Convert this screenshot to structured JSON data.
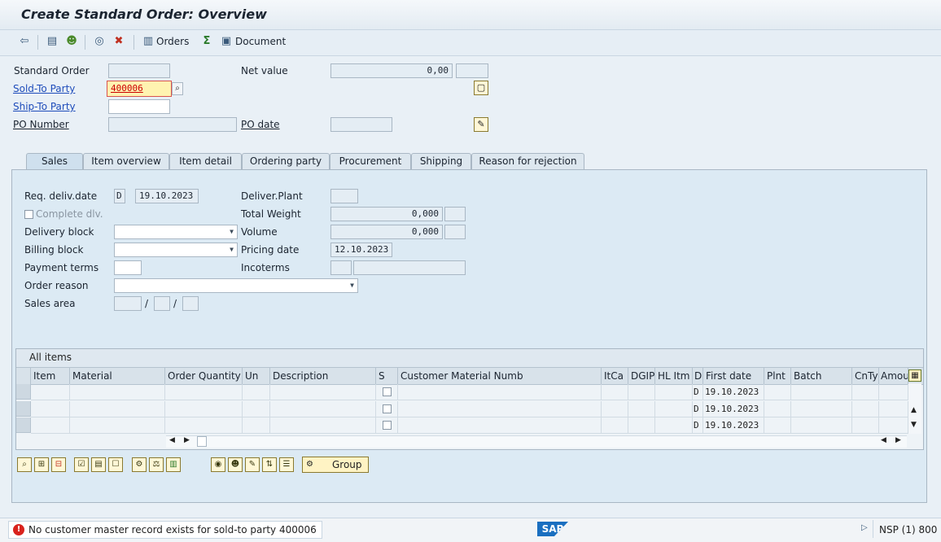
{
  "window": {
    "title": "Create Standard Order: Overview"
  },
  "toolbar": {
    "orders_label": "Orders",
    "document_label": "Document",
    "icons": [
      "display-document-flow-icon",
      "header-icon",
      "partner-icon",
      "status-icon",
      "delete-icon",
      "orders-list-icon",
      "sum-icon",
      "document-icon"
    ]
  },
  "header": {
    "standard_order": {
      "label": "Standard Order",
      "value": ""
    },
    "net_value": {
      "label": "Net value",
      "value": "0,00",
      "currency": ""
    },
    "sold_to": {
      "label": "Sold-To Party",
      "value": "400006"
    },
    "ship_to": {
      "label": "Ship-To Party",
      "value": ""
    },
    "po_number": {
      "label": "PO Number",
      "value": ""
    },
    "po_date": {
      "label": "PO date",
      "value": ""
    }
  },
  "tabs": [
    {
      "label": "Sales",
      "active": true
    },
    {
      "label": "Item overview"
    },
    {
      "label": "Item detail"
    },
    {
      "label": "Ordering party"
    },
    {
      "label": "Procurement"
    },
    {
      "label": "Shipping"
    },
    {
      "label": "Reason for rejection"
    }
  ],
  "sales": {
    "req_deliv_date": {
      "label": "Req. deliv.date",
      "format": "D",
      "value": "19.10.2023"
    },
    "complete_dlv": {
      "label": "Complete dlv."
    },
    "delivery_block": {
      "label": "Delivery block",
      "value": ""
    },
    "billing_block": {
      "label": "Billing block",
      "value": ""
    },
    "payment_terms": {
      "label": "Payment terms",
      "value": ""
    },
    "order_reason": {
      "label": "Order reason",
      "value": ""
    },
    "sales_area": {
      "label": "Sales area",
      "sep1": "/",
      "sep2": "/"
    },
    "deliver_plant": {
      "label": "Deliver.Plant",
      "value": ""
    },
    "total_weight": {
      "label": "Total Weight",
      "value": "0,000"
    },
    "volume": {
      "label": "Volume",
      "value": "0,000"
    },
    "pricing_date": {
      "label": "Pricing date",
      "value": "12.10.2023"
    },
    "incoterms": {
      "label": "Incoterms",
      "value": ""
    }
  },
  "items_table": {
    "title": "All items",
    "columns": [
      "Item",
      "Material",
      "Order Quantity",
      "Un",
      "Description",
      "S",
      "Customer Material Numb",
      "ItCa",
      "DGIP",
      "HL Itm",
      "D",
      "First date",
      "Plnt",
      "Batch",
      "CnTy",
      "Amou"
    ],
    "rows": [
      {
        "d": "D",
        "first_date": "19.10.2023"
      },
      {
        "d": "D",
        "first_date": "19.10.2023"
      },
      {
        "d": "D",
        "first_date": "19.10.2023"
      }
    ]
  },
  "bottom_toolbar": {
    "group_label": "Group"
  },
  "status_bar": {
    "message": "No customer master record exists for sold-to party 400006",
    "system": "NSP (1) 800",
    "logo": "SAP"
  }
}
